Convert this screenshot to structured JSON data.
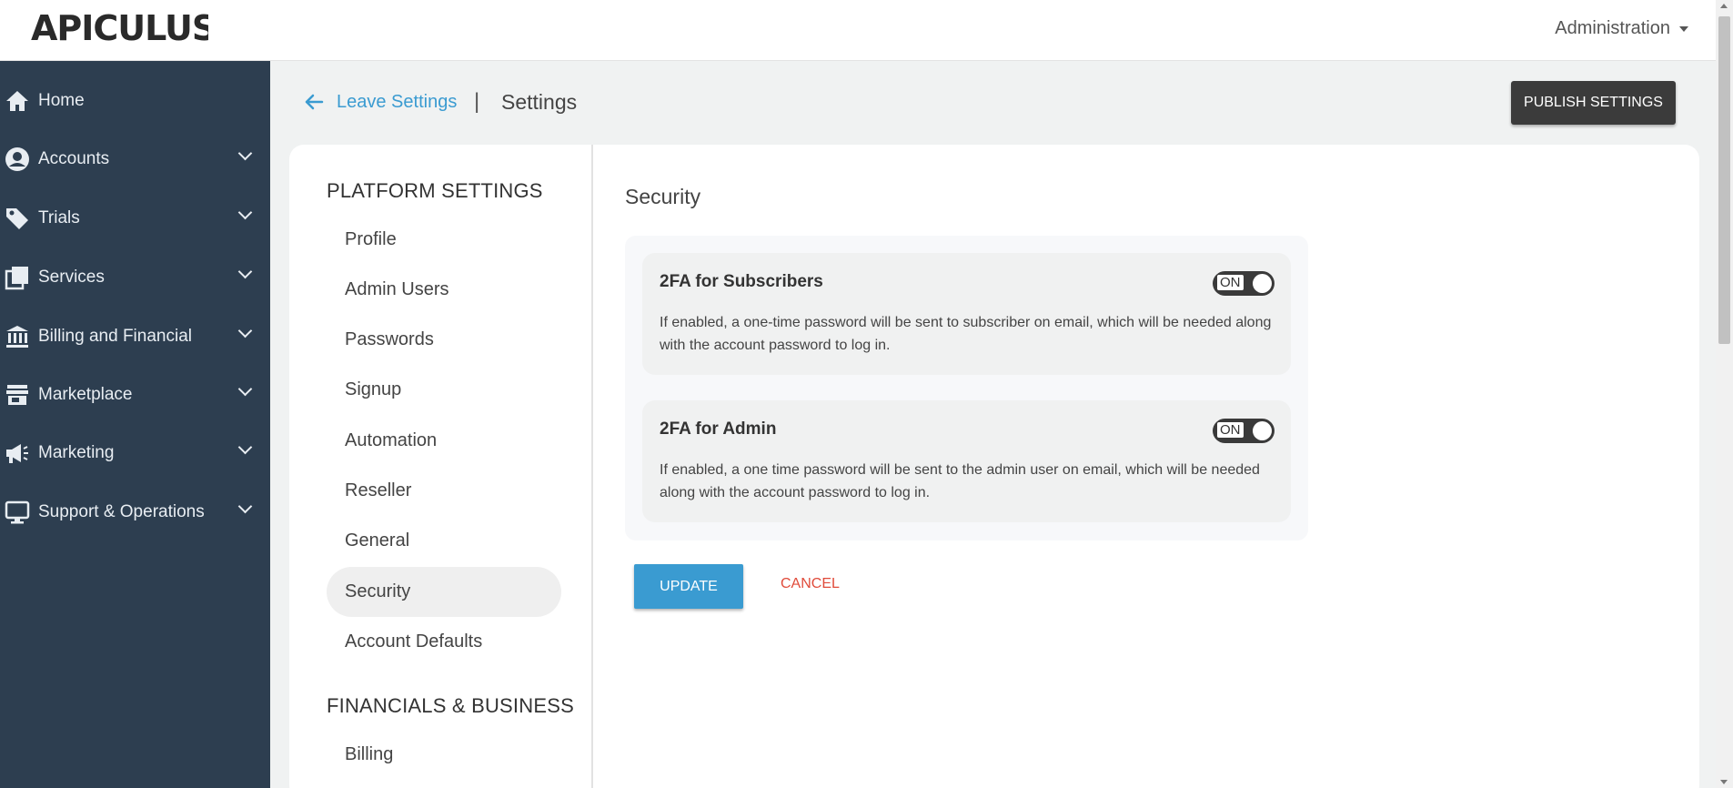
{
  "header": {
    "logo_text": "APICULUS",
    "admin_menu_label": "Administration"
  },
  "sidebar": {
    "items": [
      {
        "label": "Home",
        "icon": "home-icon",
        "has_chevron": false
      },
      {
        "label": "Accounts",
        "icon": "user-circle-icon",
        "has_chevron": true
      },
      {
        "label": "Trials",
        "icon": "tag-icon",
        "has_chevron": true
      },
      {
        "label": "Services",
        "icon": "stack-icon",
        "has_chevron": true
      },
      {
        "label": "Billing and Financial",
        "icon": "bank-icon",
        "has_chevron": true
      },
      {
        "label": "Marketplace",
        "icon": "store-icon",
        "has_chevron": true
      },
      {
        "label": "Marketing",
        "icon": "megaphone-icon",
        "has_chevron": true
      },
      {
        "label": "Support & Operations",
        "icon": "monitor-icon",
        "has_chevron": true
      }
    ]
  },
  "breadcrumb": {
    "back_label": "Leave Settings",
    "separator": "|",
    "current": "Settings"
  },
  "publish_button_label": "PUBLISH SETTINGS",
  "settings_nav": {
    "platform_heading": "PLATFORM SETTINGS",
    "platform_items": [
      "Profile",
      "Admin Users",
      "Passwords",
      "Signup",
      "Automation",
      "Reseller",
      "General",
      "Security",
      "Account Defaults"
    ],
    "active_item": "Security",
    "financial_heading": "FINANCIALS & BUSINESS",
    "financial_items": [
      "Billing"
    ]
  },
  "content": {
    "title": "Security",
    "settings": [
      {
        "title": "2FA for Subscribers",
        "description": "If enabled, a one-time password will be sent to subscriber on email, which will be needed along with the account password to log in.",
        "toggle_label": "ON"
      },
      {
        "title": "2FA for Admin",
        "description": "If enabled, a one time password will be sent to the admin user on email, which will be needed along with the account password to log in.",
        "toggle_label": "ON"
      }
    ],
    "update_label": "UPDATE",
    "cancel_label": "CANCEL"
  },
  "colors": {
    "sidebar_bg": "#2d3e50",
    "accent_blue": "#3a9bd1",
    "cancel_red": "#e04b3a",
    "publish_bg": "#3b3b3b"
  }
}
